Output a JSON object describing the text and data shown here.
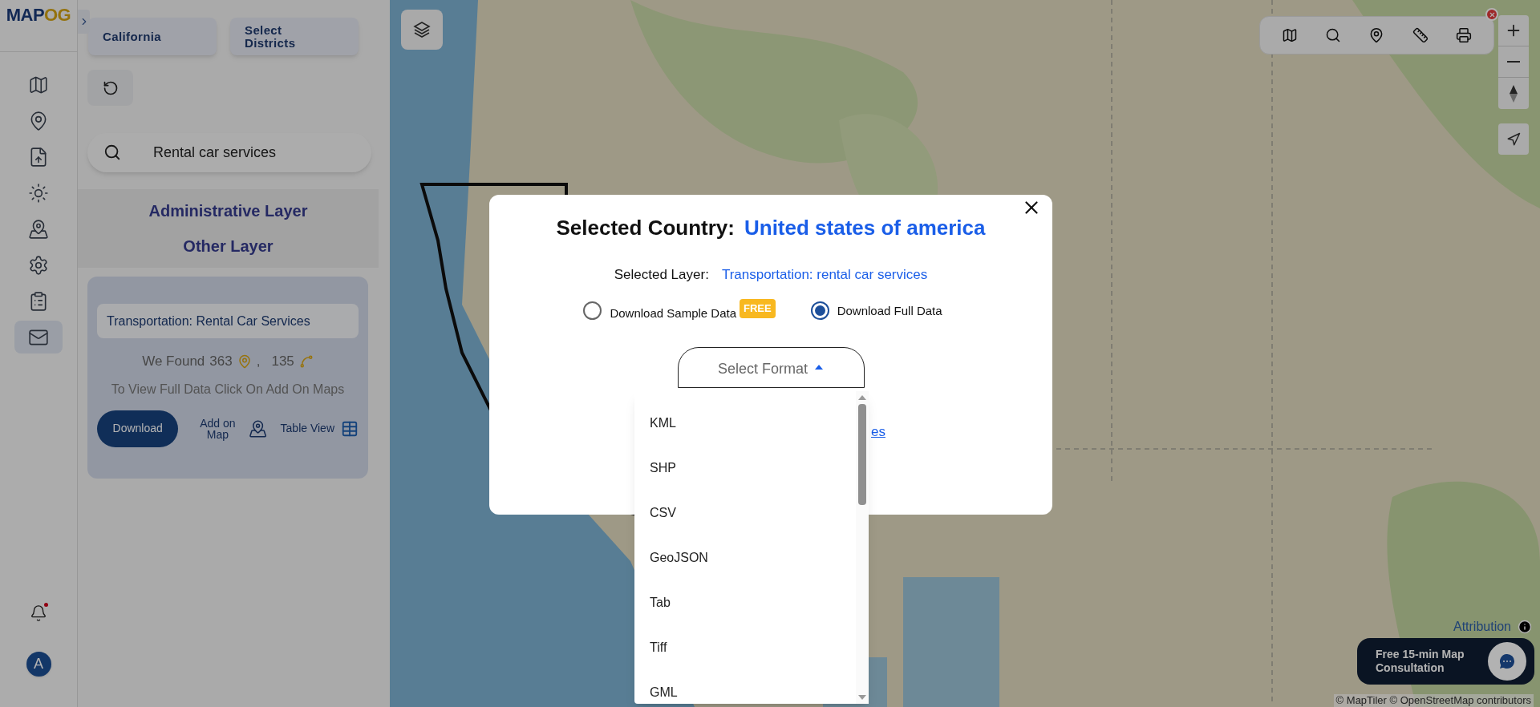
{
  "logo": {
    "part_1": "MAP",
    "part_2": "OG"
  },
  "rail": {
    "items": [
      {
        "kind": "map",
        "selected": false
      },
      {
        "kind": "pin",
        "selected": false
      },
      {
        "kind": "upload",
        "selected": false
      },
      {
        "kind": "sun",
        "selected": false
      },
      {
        "kind": "map-pin",
        "selected": false
      },
      {
        "kind": "settings",
        "selected": false
      },
      {
        "kind": "list",
        "selected": false
      },
      {
        "kind": "mail",
        "selected": true
      }
    ]
  },
  "region_buttons": [
    "California",
    "Select Districts"
  ],
  "search": {
    "value": "Rental car services"
  },
  "layer_tabs": [
    "Administrative Layer",
    "Other Layer"
  ],
  "result_card": {
    "layer": "Transportation: Rental Car Services",
    "found_label": "We Found",
    "points": "363",
    "separator": ",",
    "lines": "135",
    "hint": "To View Full Data Click On Add On Maps",
    "download": "Download",
    "add_on_map": "Add on Map",
    "table_view": "Table View"
  },
  "notifications": {
    "unread": true
  },
  "avatar": {
    "initial": "A"
  },
  "attribution": "Attribution",
  "copyright": "© MapTiler © OpenStreetMap contributors",
  "consultation": "Free 15-min Map Consultation",
  "modal": {
    "country_label": "Selected Country:",
    "country": "United states of america",
    "layer_label": "Selected Layer:",
    "layer": "Transportation: rental car services",
    "options": [
      {
        "label": "Download Sample Data",
        "badge": "FREE",
        "selected": false
      },
      {
        "label": "Download Full Data",
        "selected": true
      }
    ],
    "format_select": {
      "placeholder": "Select Format",
      "expanded": true
    },
    "link_fragment": "es",
    "format_options": [
      "KML",
      "SHP",
      "CSV",
      "GeoJSON",
      "Tab",
      "Tiff",
      "GML"
    ]
  }
}
